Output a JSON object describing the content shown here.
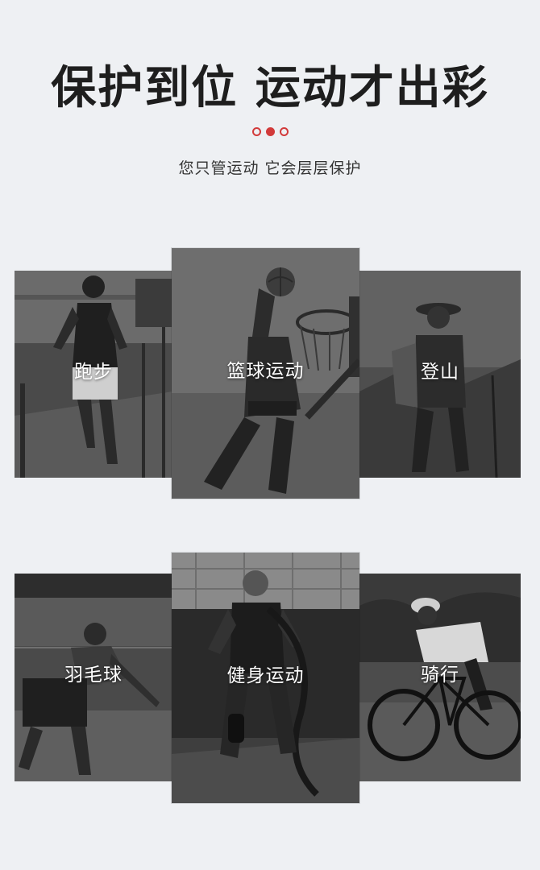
{
  "header": {
    "title": "保护到位 运动才出彩",
    "subtitle": "您只管运动 它会层层保护",
    "accent_color": "#d23a3a"
  },
  "row1": [
    {
      "label": "跑步",
      "icon": "running-scene"
    },
    {
      "label": "篮球运动",
      "icon": "basketball-scene"
    },
    {
      "label": "登山",
      "icon": "hiking-scene"
    }
  ],
  "row2": [
    {
      "label": "羽毛球",
      "icon": "badminton-scene"
    },
    {
      "label": "健身运动",
      "icon": "fitness-scene"
    },
    {
      "label": "骑行",
      "icon": "cycling-scene"
    }
  ]
}
